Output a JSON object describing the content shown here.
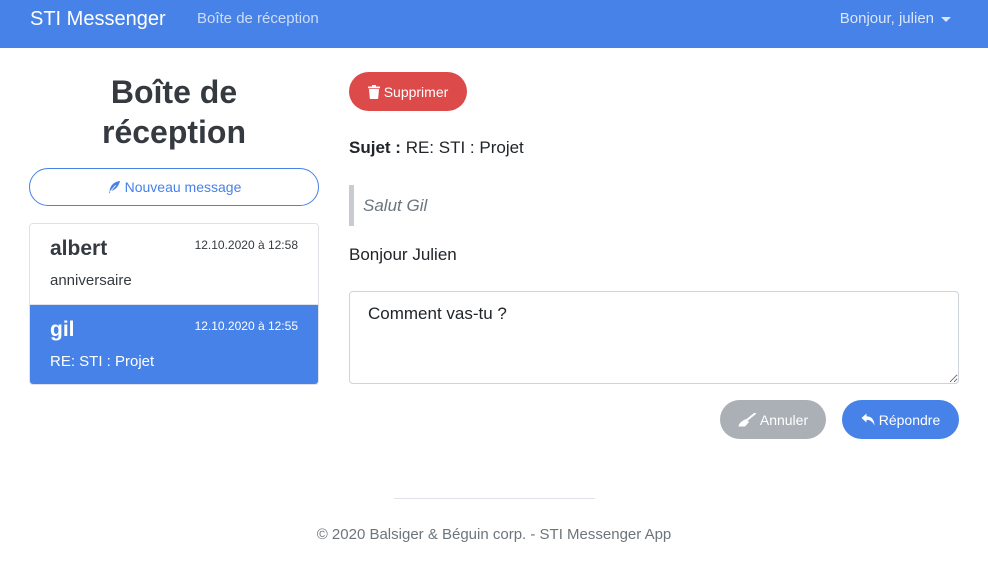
{
  "navbar": {
    "brand": "STI Messenger",
    "inbox_link": "Boîte de réception",
    "user_greeting": "Bonjour, julien",
    "accent_color": "#4682e8"
  },
  "sidebar": {
    "title_line1": "Boîte de",
    "title_line2": "réception",
    "new_message_label": "Nouveau message",
    "new_message_icon": "feather-icon",
    "messages": [
      {
        "sender": "albert",
        "date": "12.10.2020 à 12:58",
        "subject": "anniversaire",
        "active": false
      },
      {
        "sender": "gil",
        "date": "12.10.2020 à 12:55",
        "subject": "RE: STI : Projet",
        "active": true
      }
    ]
  },
  "message_view": {
    "delete_label": "Supprimer",
    "delete_icon": "trash-icon",
    "delete_color": "#dc4a4a",
    "subject_label": "Sujet :",
    "subject_value": "RE: STI : Projet",
    "quoted_text": "Salut Gil",
    "body_text": "Bonjour Julien",
    "reply_value": "Comment vas-tu ?",
    "cancel_label": "Annuler",
    "cancel_icon": "broom-icon",
    "reply_label": "Répondre",
    "reply_icon": "reply-icon"
  },
  "footer": {
    "text": "© 2020 Balsiger & Béguin corp. - STI Messenger App"
  }
}
